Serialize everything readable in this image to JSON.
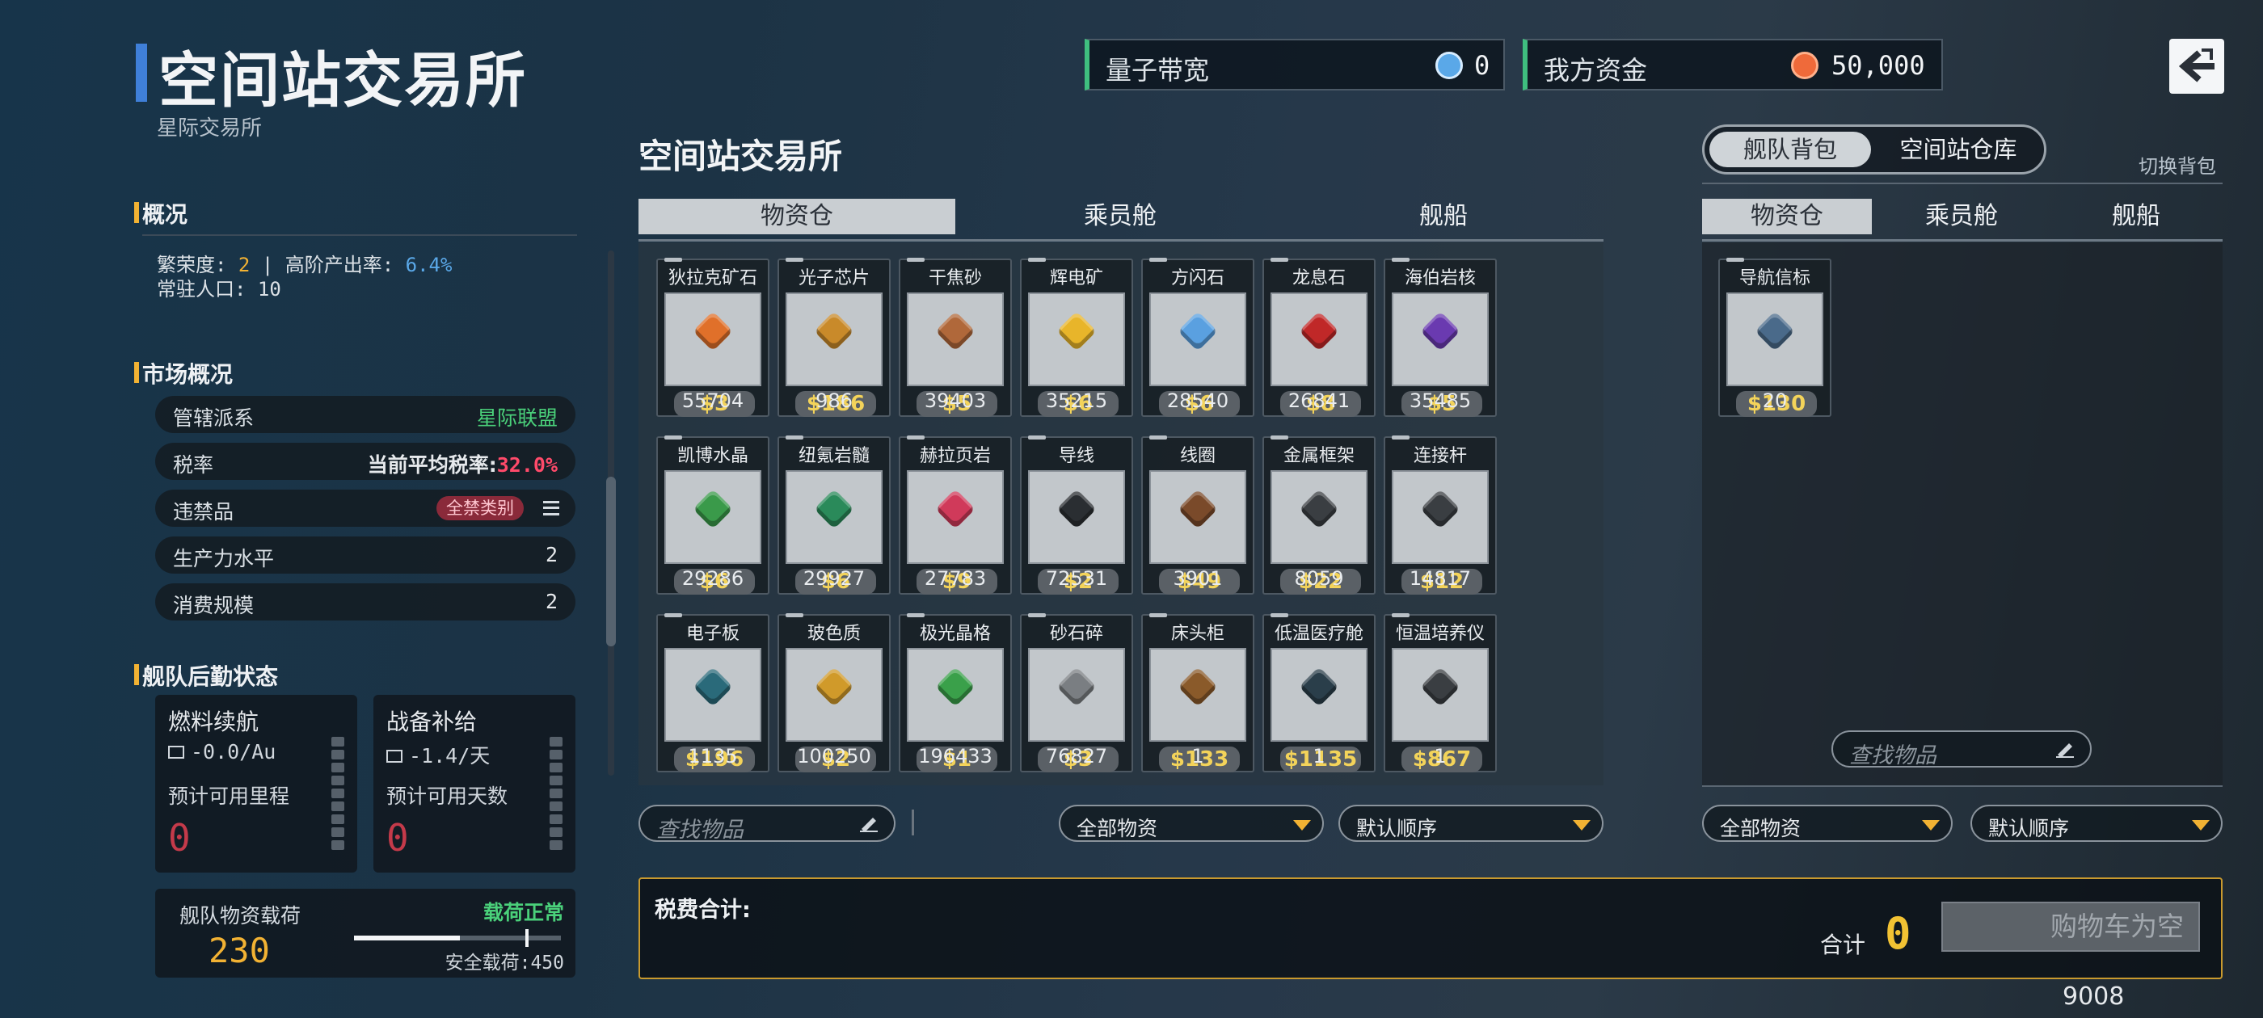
{
  "header": {
    "title": "空间站交易所",
    "subtitle": "星际交易所"
  },
  "top_stats": {
    "bandwidth": {
      "label": "量子带宽",
      "value": "0",
      "icon": "quantum-icon"
    },
    "funds": {
      "label": "我方资金",
      "value": "50,000",
      "icon": "coin-icon"
    }
  },
  "overview": {
    "heading": "概况",
    "prosperity_label": "繁荣度:",
    "prosperity_value": "2",
    "separator": "|",
    "high_output_label": "高阶产出率:",
    "high_output_value": "6.4%",
    "population_label": "常驻人口:",
    "population_value": "10"
  },
  "market": {
    "heading": "市场概况",
    "rows": [
      {
        "label": "管辖派系",
        "value": "星际联盟"
      },
      {
        "label": "税率",
        "value_label": "当前平均税率:",
        "value": "32.0%"
      },
      {
        "label": "违禁品",
        "badge": "全禁类别"
      },
      {
        "label": "生产力水平",
        "value": "2"
      },
      {
        "label": "消费规模",
        "value": "2"
      }
    ]
  },
  "logistics": {
    "heading": "舰队后勤状态",
    "fuel": {
      "title": "燃料续航",
      "rate": "-0.0/Au",
      "sub": "预计可用里程",
      "value": "0"
    },
    "supply": {
      "title": "战备补给",
      "rate": "-1.4/天",
      "sub": "预计可用天数",
      "value": "0"
    },
    "cargo": {
      "title": "舰队物资载荷",
      "value": "230",
      "status": "载荷正常",
      "safe_label": "安全载荷:",
      "safe_value": "450",
      "fill_fraction": 0.51
    }
  },
  "exchange": {
    "title": "空间站交易所",
    "tabs": [
      "物资仓",
      "乘员舱",
      "舰船"
    ],
    "active_tab": 0,
    "items": [
      {
        "name": "狄拉克矿石",
        "price": "$3",
        "qty": "55704",
        "icon": "orange-crystal-icon",
        "color": "#e0702a"
      },
      {
        "name": "光子芯片",
        "price": "$186",
        "qty": "986",
        "icon": "chip-icon",
        "color": "#c98a2a"
      },
      {
        "name": "干焦砂",
        "price": "$5",
        "qty": "39403",
        "icon": "ore-icon",
        "color": "#b0683a"
      },
      {
        "name": "辉电矿",
        "price": "$6",
        "qty": "35215",
        "icon": "yellow-crystal-icon",
        "color": "#e8b52a"
      },
      {
        "name": "方闪石",
        "price": "$6",
        "qty": "28540",
        "icon": "blue-crystal-icon",
        "color": "#5aa0e0"
      },
      {
        "name": "龙息石",
        "price": "$8",
        "qty": "26841",
        "icon": "red-stone-icon",
        "color": "#c02828"
      },
      {
        "name": "海伯岩核",
        "price": "$5",
        "qty": "35485",
        "icon": "purple-stone-icon",
        "color": "#6a3ab0"
      },
      {
        "name": "凯博水晶",
        "price": "$6",
        "qty": "29286",
        "icon": "green-crystal-icon",
        "color": "#3a9a4a"
      },
      {
        "name": "纽氪岩髓",
        "price": "$6",
        "qty": "29927",
        "icon": "green-gem-icon",
        "color": "#2a8a5a"
      },
      {
        "name": "赫拉页岩",
        "price": "$9",
        "qty": "27783",
        "icon": "pink-slab-icon",
        "color": "#d03a5a"
      },
      {
        "name": "导线",
        "price": "$2",
        "qty": "72531",
        "icon": "wire-coil-icon",
        "color": "#2a2e32"
      },
      {
        "name": "线圈",
        "price": "$49",
        "qty": "3901",
        "icon": "coil-icon",
        "color": "#7a4a2a"
      },
      {
        "name": "金属框架",
        "price": "$22",
        "qty": "8059",
        "icon": "frame-icon",
        "color": "#3a3e42"
      },
      {
        "name": "连接杆",
        "price": "$12",
        "qty": "14817",
        "icon": "rod-icon",
        "color": "#3a3e42"
      },
      {
        "name": "电子板",
        "price": "$196",
        "qty": "1135",
        "icon": "circuit-board-icon",
        "color": "#2a6a7a"
      },
      {
        "name": "玻色质",
        "price": "$2",
        "qty": "100250",
        "icon": "amber-hex-icon",
        "color": "#d09a2a"
      },
      {
        "name": "极光晶格",
        "price": "$1",
        "qty": "196433",
        "icon": "green-pyramid-icon",
        "color": "#3aa04a"
      },
      {
        "name": "砂石碎",
        "price": "$3",
        "qty": "76827",
        "icon": "gravel-icon",
        "color": "#7a7e82"
      },
      {
        "name": "床头柜",
        "price": "$133",
        "qty": "1",
        "icon": "nightstand-icon",
        "color": "#8a5a2a"
      },
      {
        "name": "低温医疗舱",
        "price": "$1135",
        "qty": "1",
        "icon": "medical-pod-icon",
        "color": "#2a3e4a"
      },
      {
        "name": "恒温培养仪",
        "price": "$867",
        "qty": "1",
        "icon": "incubator-icon",
        "color": "#3a3e42"
      }
    ],
    "search_placeholder": "查找物品",
    "filter": "全部物资",
    "sort": "默认顺序"
  },
  "inventory": {
    "toggle": [
      "舰队背包",
      "空间站仓库"
    ],
    "active_toggle": 0,
    "switch_label": "切换背包",
    "tabs": [
      "物资仓",
      "乘员舱",
      "舰船"
    ],
    "active_tab": 0,
    "items": [
      {
        "name": "导航信标",
        "price": "$130",
        "qty": "20",
        "icon": "nav-beacon-icon",
        "color": "#4a6a8a"
      }
    ],
    "search_placeholder": "查找物品",
    "filter": "全部物资",
    "sort": "默认顺序"
  },
  "tax": {
    "label": "税费合计:",
    "total_label": "合计",
    "total_value": "0",
    "cart_button": "购物车为空"
  },
  "footer_number": "9008"
}
